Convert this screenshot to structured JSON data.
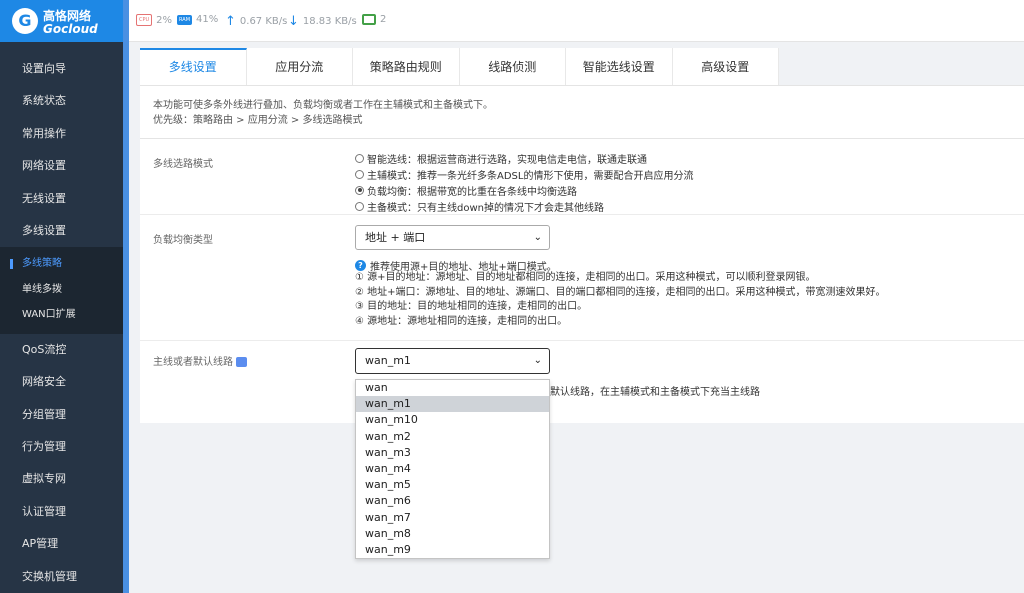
{
  "brand": {
    "name_cn": "高恪网络",
    "name_en": "Gocloud",
    "accent": "#1e88e5"
  },
  "sidebar": {
    "items_top": [
      "设置向导",
      "系统状态",
      "常用操作",
      "网络设置",
      "无线设置",
      "多线设置"
    ],
    "sub_items": [
      "多线策略",
      "单线多拨",
      "WAN口扩展"
    ],
    "items_bottom": [
      "QoS流控",
      "网络安全",
      "分组管理",
      "行为管理",
      "虚拟专网",
      "认证管理",
      "AP管理",
      "交换机管理"
    ]
  },
  "status": {
    "cpu_chip": "CPU",
    "cpu": "2%",
    "ram_chip": "RAM",
    "ram": "41%",
    "up": "0.67 KB/s",
    "down": "18.83 KB/s",
    "devices": "2"
  },
  "tabs": [
    "多线设置",
    "应用分流",
    "策略路由规则",
    "线路侦测",
    "智能选线设置",
    "高级设置"
  ],
  "description": {
    "line1": "本功能可使多条外线进行叠加、负载均衡或者工作在主辅模式和主备模式下。",
    "line2": "优先级：策略路由 > 应用分流 > 多线选路模式"
  },
  "mode": {
    "label": "多线选路模式",
    "options": [
      "智能选线：根据运营商进行选路，实现电信走电信，联通走联通",
      "主辅模式：推荐一条光纤多条ADSL的情形下使用，需要配合开启应用分流",
      "负载均衡：根据带宽的比重在各条线中均衡选路",
      "主备模式：只有主线down掉的情况下才会走其他线路"
    ],
    "selected_index": 2
  },
  "balance": {
    "label": "负载均衡类型",
    "value": "地址 + 端口",
    "hint": "推荐使用源+目的地址、地址+端口模式。",
    "notes": [
      "① 源+目的地址：源地址、目的地址都相同的连接，走相同的出口。采用这种模式，可以顺利登录网银。",
      "② 地址+端口：源地址、目的地址、源端口、目的端口都相同的连接，走相同的出口。采用这种模式，带宽测速效果好。",
      "③ 目的地址：目的地址相同的连接，走相同的出口。",
      "④ 源地址：源地址相同的连接，走相同的出口。"
    ]
  },
  "main_line": {
    "label": "主线或者默认线路",
    "value": "wan_m1",
    "note": "为默认线路，在主辅模式和主备模式下充当主线路",
    "options": [
      "wan",
      "wan_m1",
      "wan_m10",
      "wan_m2",
      "wan_m3",
      "wan_m4",
      "wan_m5",
      "wan_m6",
      "wan_m7",
      "wan_m8",
      "wan_m9"
    ],
    "highlighted_index": 1
  }
}
